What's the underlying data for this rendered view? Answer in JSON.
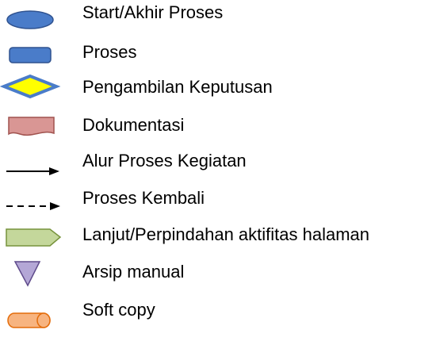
{
  "legend": {
    "items": [
      {
        "symbol": "ellipse",
        "label": "Start/Akhir Proses"
      },
      {
        "symbol": "rounded-rectangle",
        "label": "Proses"
      },
      {
        "symbol": "diamond",
        "label": "Pengambilan Keputusan"
      },
      {
        "symbol": "document",
        "label": "Dokumentasi"
      },
      {
        "symbol": "solid-arrow",
        "label": "Alur Proses Kegiatan"
      },
      {
        "symbol": "dashed-arrow",
        "label": "Proses Kembali"
      },
      {
        "symbol": "pentagon-arrow",
        "label": "Lanjut/Perpindahan aktifitas halaman"
      },
      {
        "symbol": "inverted-triangle",
        "label": "Arsip manual"
      },
      {
        "symbol": "cylinder",
        "label": "Soft copy"
      }
    ]
  },
  "colors": {
    "process_blue": "#4A7CC9",
    "process_blue_border": "#2F528F",
    "decision_yellow": "#FFFF00",
    "document_red": "#D99694",
    "document_red_border": "#A0524E",
    "offpage_green": "#C4D79B",
    "offpage_green_border": "#77933C",
    "archive_purple": "#B4A7D6",
    "archive_purple_border": "#5F4B8B",
    "softcopy_orange": "#F7B480",
    "softcopy_orange_border": "#E46C0A",
    "line_black": "#000000"
  }
}
